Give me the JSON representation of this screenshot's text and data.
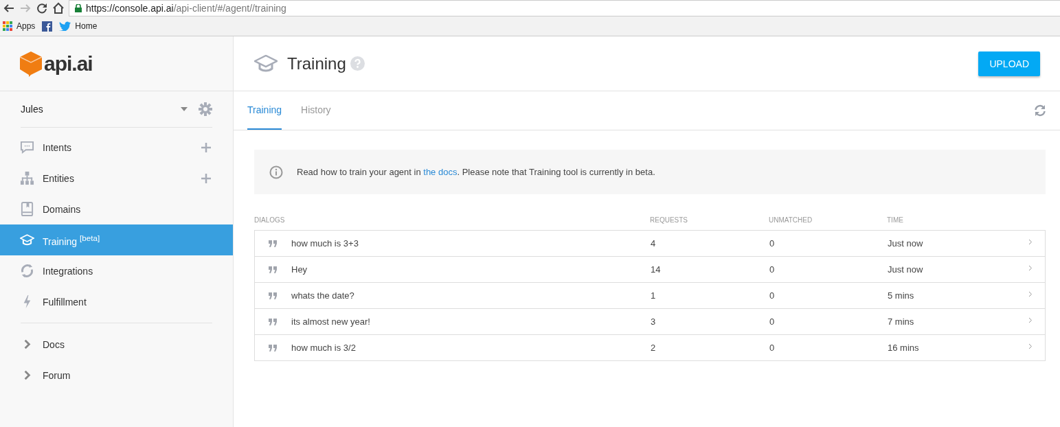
{
  "browser": {
    "url_host": "https://console.api.ai",
    "url_path": "/api-client/#/agent//training",
    "bookmarks": [
      {
        "kind": "labeled",
        "label": "Apps"
      },
      {
        "kind": "icon_only"
      },
      {
        "kind": "labeled",
        "label": "Home"
      }
    ]
  },
  "sidebar": {
    "logo": "api.ai",
    "agent": "Jules",
    "items": [
      {
        "kind": "nav",
        "label": "Intents",
        "addable": true,
        "selected": false
      },
      {
        "kind": "nav",
        "label": "Entities",
        "addable": true,
        "selected": false
      },
      {
        "kind": "nav",
        "label": "Domains",
        "addable": false,
        "selected": false
      },
      {
        "kind": "nav",
        "label": "Training $^{[beta]}$",
        "addable": false,
        "selected": true
      },
      {
        "kind": "nav",
        "label": "Integrations",
        "addable": false,
        "selected": false
      },
      {
        "kind": "nav",
        "label": "Fulfillment",
        "addable": false,
        "selected": false
      },
      {
        "kind": "divider"
      },
      {
        "kind": "link",
        "label": "Docs",
        "selected": false
      },
      {
        "kind": "link",
        "label": "Forum",
        "selected": false
      }
    ]
  },
  "header": {
    "title": "Training",
    "button": "UPLOAD"
  },
  "tabs": [
    {
      "label": "Training",
      "selected": true
    },
    {
      "label": "History",
      "selected": false
    }
  ],
  "notice": {
    "before": "Read how to train your agent in ",
    "link": "the docs",
    "after": ". Please note that Training tool is currently in beta."
  },
  "table": {
    "columns": [
      "DIALOGS",
      "REQUESTS",
      "UNMATCHED",
      "TIME"
    ],
    "rows": [
      {
        "dialog": "how much is 3+3",
        "requests": "4",
        "unmatched": "0",
        "time": "Just now"
      },
      {
        "dialog": "Hey",
        "requests": "14",
        "unmatched": "0",
        "time": "Just now"
      },
      {
        "dialog": "whats the date?",
        "requests": "1",
        "unmatched": "0",
        "time": "5 mins"
      },
      {
        "dialog": "its almost new year!",
        "requests": "3",
        "unmatched": "0",
        "time": "7 mins"
      },
      {
        "dialog": "how much is 3/2",
        "requests": "2",
        "unmatched": "0",
        "time": "16 mins"
      }
    ]
  }
}
